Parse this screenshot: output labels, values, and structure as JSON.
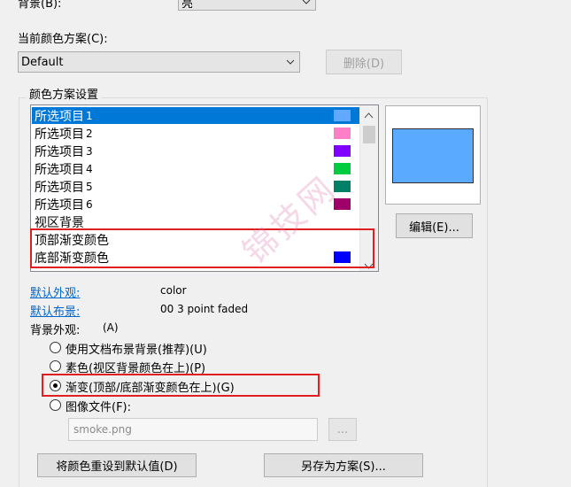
{
  "top": {
    "background_label": "背景(B):",
    "background_value": "亮",
    "scheme_label": "当前颜色方案(C):",
    "scheme_value": "Default",
    "delete_button": "删除(D)"
  },
  "color_settings": {
    "group_title": "颜色方案设置",
    "items": [
      {
        "label": "所选项目",
        "index": "1",
        "swatch": "#62a8ff",
        "selected": true
      },
      {
        "label": "所选项目",
        "index": "2",
        "swatch": "#ff7fc6",
        "selected": false
      },
      {
        "label": "所选项目",
        "index": "3",
        "swatch": "#8000ff",
        "selected": false
      },
      {
        "label": "所选项目",
        "index": "4",
        "swatch": "#00cc40",
        "selected": false
      },
      {
        "label": "所选项目",
        "index": "5",
        "swatch": "#008066",
        "selected": false
      },
      {
        "label": "所选项目",
        "index": "6",
        "swatch": "#a0006a",
        "selected": false
      },
      {
        "label": "视区背景",
        "index": "",
        "swatch": "",
        "selected": false
      },
      {
        "label": "顶部渐变颜色",
        "index": "",
        "swatch": "",
        "selected": false
      },
      {
        "label": "底部渐变颜色",
        "index": "",
        "swatch": "#0000ff",
        "selected": false
      }
    ],
    "preview_color": "#5aabff",
    "edit_button": "编辑(E)..."
  },
  "defaults": {
    "appearance_link": "默认外观:",
    "appearance_value": "color",
    "layout_link": "默认布景:",
    "layout_value": "00 3 point faded"
  },
  "bg_appearance": {
    "label": "背景外观:",
    "hotkey": "(A)",
    "options": [
      "使用文档布景背景(推荐)(U)",
      "素色(视区背景颜色在上)(P)",
      "渐变(顶部/底部渐变颜色在上)(G)",
      "图像文件(F):"
    ],
    "selected_index": 2,
    "image_path": "smoke.png",
    "browse_button": "..."
  },
  "bottom": {
    "reset_button": "将颜色重设到默认值(D)",
    "save_button": "另存为方案(S)..."
  },
  "watermark": "锦技网"
}
